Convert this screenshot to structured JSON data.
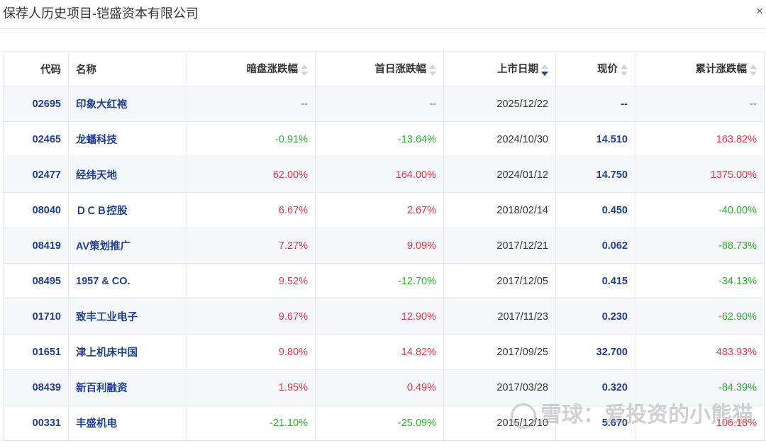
{
  "header": {
    "title": "保荐人历史项目-铠盛资本有限公司",
    "close": "×"
  },
  "columns": {
    "code": "代码",
    "name": "名称",
    "dark": "暗盘涨跌幅",
    "first_day": "首日涨跌幅",
    "list_date": "上市日期",
    "price": "现价",
    "cumulative": "累计涨跌幅"
  },
  "rows": [
    {
      "code": "02695",
      "name": "印象大红袍",
      "dark": "--",
      "first_day": "--",
      "date": "2025/12/22",
      "price": "--",
      "cum": "--"
    },
    {
      "code": "02465",
      "name": "龙蟠科技",
      "dark": "-0.91%",
      "first_day": "-13.64%",
      "date": "2024/10/30",
      "price": "14.510",
      "cum": "163.82%"
    },
    {
      "code": "02477",
      "name": "经纬天地",
      "dark": "62.00%",
      "first_day": "164.00%",
      "date": "2024/01/12",
      "price": "14.750",
      "cum": "1375.00%"
    },
    {
      "code": "08040",
      "name": "ＤＣＢ控股",
      "dark": "6.67%",
      "first_day": "2.67%",
      "date": "2018/02/14",
      "price": "0.450",
      "cum": "-40.00%"
    },
    {
      "code": "08419",
      "name": "AV策划推广",
      "dark": "7.27%",
      "first_day": "9.09%",
      "date": "2017/12/21",
      "price": "0.062",
      "cum": "-88.73%"
    },
    {
      "code": "08495",
      "name": "1957 & CO.",
      "dark": "9.52%",
      "first_day": "-12.70%",
      "date": "2017/12/05",
      "price": "0.415",
      "cum": "-34.13%"
    },
    {
      "code": "01710",
      "name": "致丰工业电子",
      "dark": "9.67%",
      "first_day": "12.90%",
      "date": "2017/11/23",
      "price": "0.230",
      "cum": "-62.90%"
    },
    {
      "code": "01651",
      "name": "津上机床中国",
      "dark": "9.80%",
      "first_day": "14.82%",
      "date": "2017/09/25",
      "price": "32.700",
      "cum": "483.93%"
    },
    {
      "code": "08439",
      "name": "新百利融资",
      "dark": "1.95%",
      "first_day": "0.49%",
      "date": "2017/03/28",
      "price": "0.320",
      "cum": "-84.39%"
    },
    {
      "code": "00331",
      "name": "丰盛机电",
      "dark": "-21.10%",
      "first_day": "-25.09%",
      "date": "2015/12/10",
      "price": "5.670",
      "cum": "106.18%"
    }
  ],
  "watermark": "雪球：爱投资的小熊猫",
  "colors": {
    "up": "#e63946",
    "down": "#2cb02c",
    "link": "#1f3f8a"
  }
}
